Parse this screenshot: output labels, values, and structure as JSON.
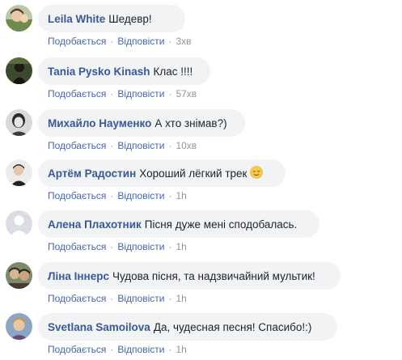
{
  "comments": [
    {
      "author": "Leila White",
      "text": "Шедевр!",
      "like": "Подобається",
      "reply": "Відповісти",
      "time": "3хв",
      "avatar": "avatar-leila"
    },
    {
      "author": "Tania Pysko Kinash",
      "text": "Клас !!!!",
      "like": "Подобається",
      "reply": "Відповісти",
      "time": "57хв",
      "avatar": "avatar-tania"
    },
    {
      "author": "Михайло Науменко",
      "text": "А хто знімав?)",
      "like": "Подобається",
      "reply": "Відповісти",
      "time": "10хв",
      "avatar": "avatar-mykhailo"
    },
    {
      "author": "Артём Радостин",
      "text": "Хороший лёгкий трек",
      "emoji": "relieved-face-emoji",
      "like": "Подобається",
      "reply": "Відповісти",
      "time": "1h",
      "avatar": "avatar-artem"
    },
    {
      "author": "Алена Плахотник",
      "text": "Пісня дуже мені сподобалась.",
      "like": "Подобається",
      "reply": "Відповісти",
      "time": "1h",
      "avatar": "avatar-default"
    },
    {
      "author": "Ліна Іннерс",
      "text": "Чудова пісня, та надзвичайний мультик!",
      "like": "Подобається",
      "reply": "Відповісти",
      "time": "1h",
      "avatar": "avatar-lina"
    },
    {
      "author": "Svetlana Samoilova",
      "text": "Да, чудесная песня! Спасибо!:)",
      "like": "Подобається",
      "reply": "Відповісти",
      "time": "1h",
      "avatar": "avatar-svetlana"
    }
  ],
  "separator": "·",
  "colors": {
    "author": "#385898",
    "action": "#4267b2",
    "meta": "#90949c",
    "bubble": "#f2f3f5"
  }
}
